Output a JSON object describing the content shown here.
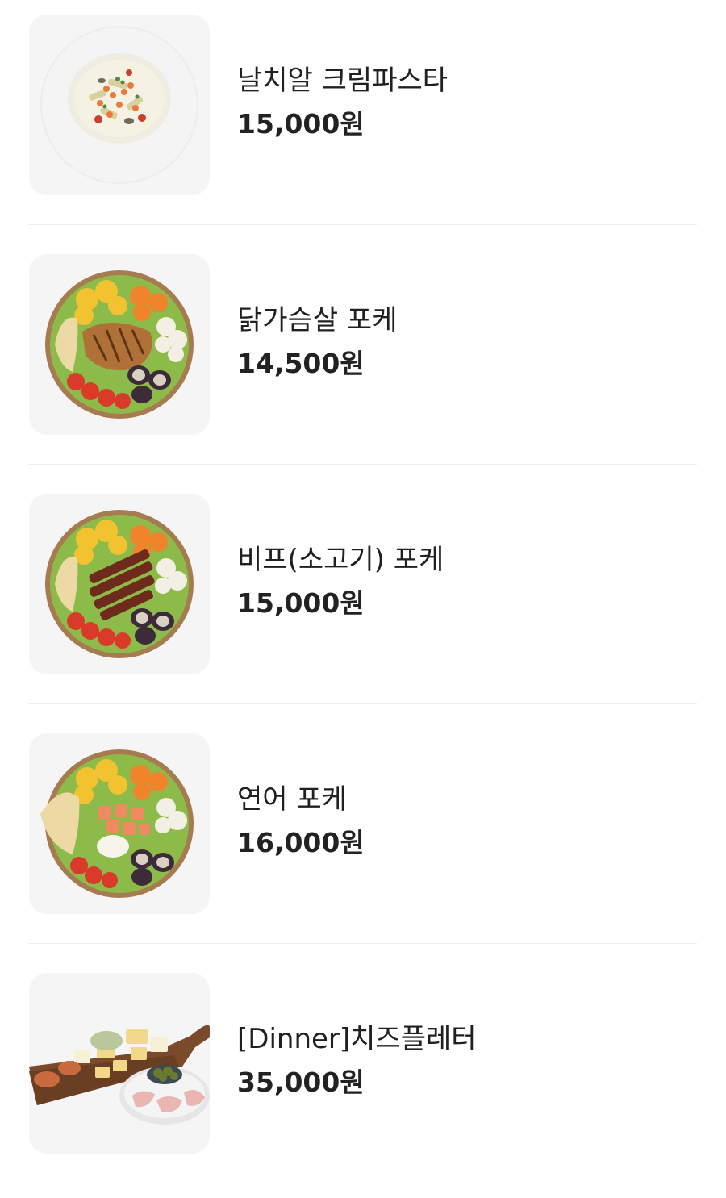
{
  "menu": {
    "items": [
      {
        "name": "날치알 크림파스타",
        "price": "15,000원",
        "image_icon": "cream-pasta-image"
      },
      {
        "name": "닭가슴살 포케",
        "price": "14,500원",
        "image_icon": "chicken-poke-bowl-image"
      },
      {
        "name": "비프(소고기) 포케",
        "price": "15,000원",
        "image_icon": "beef-poke-bowl-image"
      },
      {
        "name": "연어 포케",
        "price": "16,000원",
        "image_icon": "salmon-poke-bowl-image"
      },
      {
        "name": "[Dinner]치즈플레터",
        "price": "35,000원",
        "image_icon": "cheese-platter-image"
      }
    ]
  }
}
